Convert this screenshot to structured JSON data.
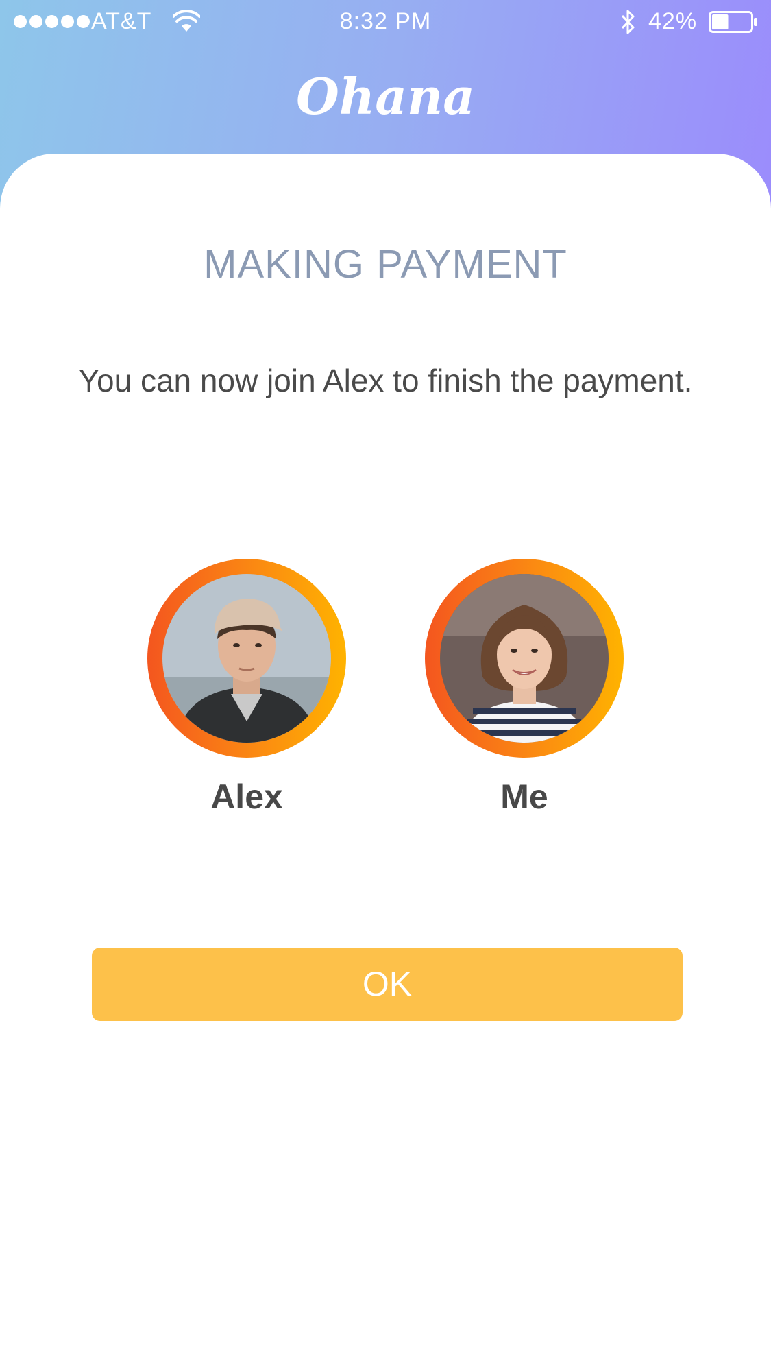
{
  "status_bar": {
    "carrier": "AT&T",
    "time": "8:32 PM",
    "battery": "42%",
    "battery_level": 0.42,
    "signal_bars": 5,
    "icons": [
      "wifi-icon",
      "bluetooth-icon",
      "battery-icon"
    ]
  },
  "header": {
    "app_name": "Ohana",
    "gradient_start": "#8ec6ea",
    "gradient_end": "#9b8cfc"
  },
  "main": {
    "title": "MAKING PAYMENT",
    "message": "You can now join Alex to finish the payment.",
    "participants": [
      {
        "name": "Alex"
      },
      {
        "name": "Me"
      }
    ],
    "ok_label": "OK"
  },
  "colors": {
    "accent": "#fdc14a",
    "ring_start": "#f4561f",
    "ring_end": "#ffb300"
  }
}
